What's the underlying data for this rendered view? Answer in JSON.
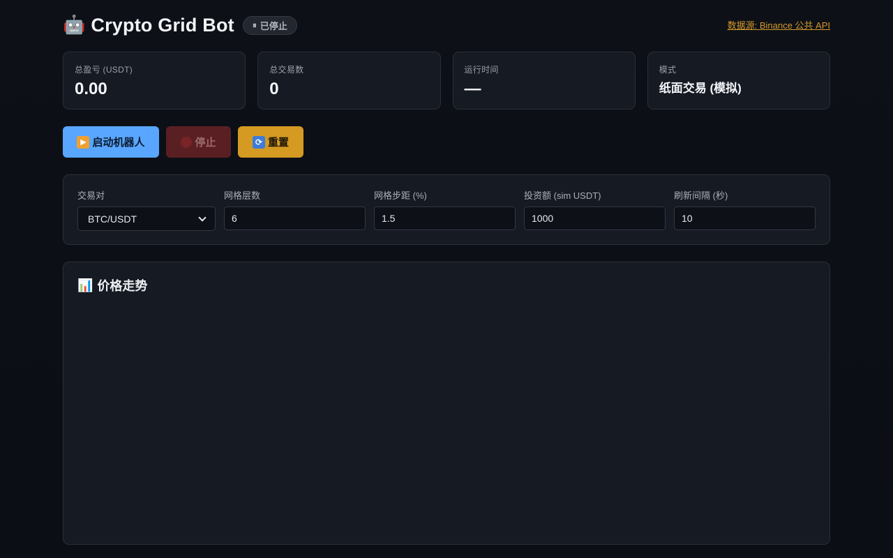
{
  "header": {
    "robot_icon": "🤖",
    "title": "Crypto Grid Bot",
    "status_icon": "⏸",
    "status_label": "已停止",
    "source_link": "数据源: Binance 公共 API",
    "accent_color": "#d49a2a"
  },
  "stats": {
    "pnl_label": "总盈亏 (USDT)",
    "pnl_value": "0.00",
    "trades_label": "总交易数",
    "trades_value": "0",
    "runtime_label": "运行时间",
    "runtime_value": "—",
    "mode_label": "模式",
    "mode_value": "纸面交易 (模拟)"
  },
  "actions": {
    "start_icon": "▶",
    "start_label": "启动机器人",
    "stop_label": "停止",
    "reset_icon": "⟳",
    "reset_label": "重置"
  },
  "config": {
    "pair_label": "交易对",
    "pair_value": "BTC/USDT",
    "levels_label": "网格层数",
    "levels_value": "6",
    "step_label": "网格步距 (%)",
    "step_value": "1.5",
    "invest_label": "投资额 (sim USDT)",
    "invest_value": "1000",
    "refresh_label": "刷新间隔 (秒)",
    "refresh_value": "10"
  },
  "chart": {
    "icon": "📊",
    "title": "价格走势"
  }
}
